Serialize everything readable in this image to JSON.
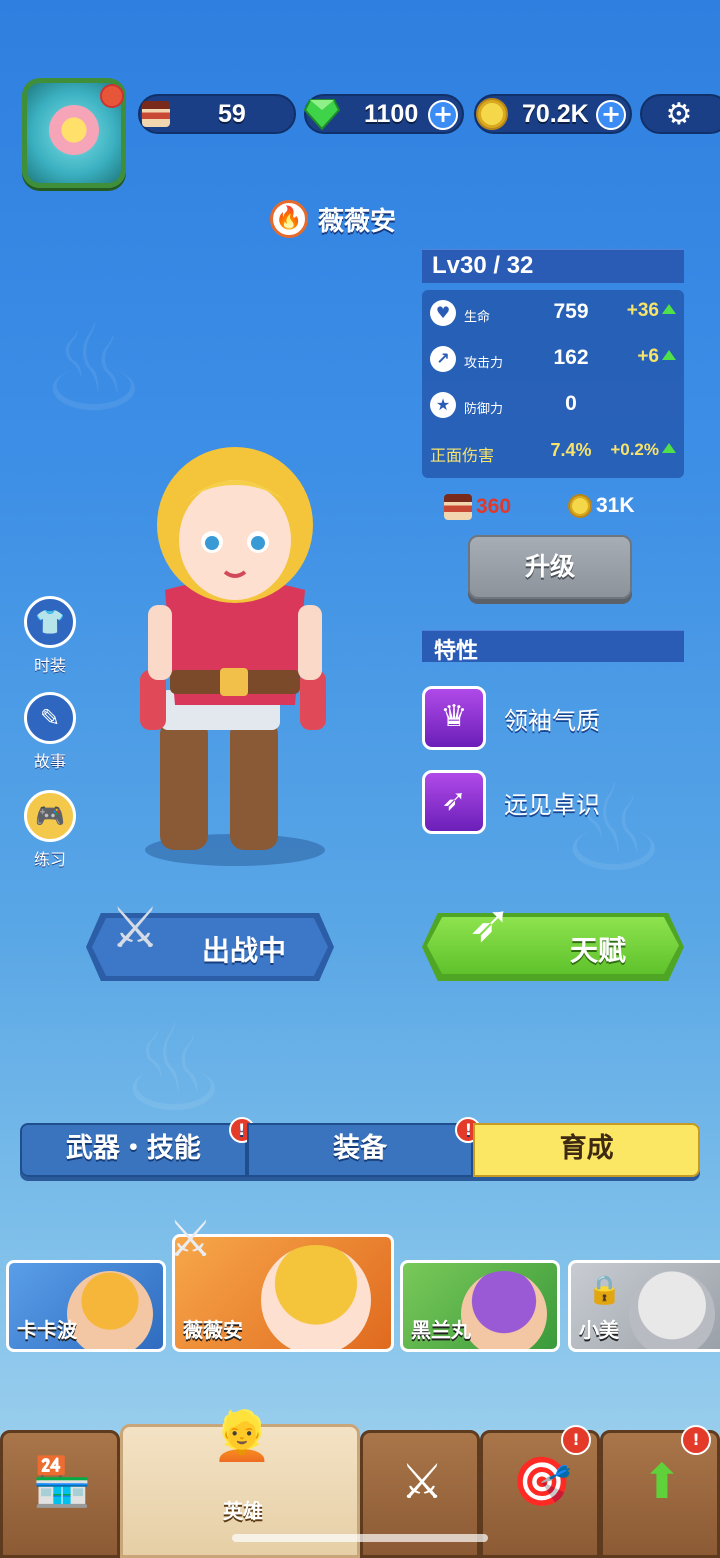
{
  "resources": {
    "cake": "59",
    "gems": "1100",
    "coins": "70.2K"
  },
  "hero": {
    "name": "薇薇安",
    "level": "Lv30 / 32"
  },
  "stats": [
    {
      "label": "生命",
      "value": "759",
      "bonus": "+36"
    },
    {
      "label": "攻击力",
      "value": "162",
      "bonus": "+6"
    },
    {
      "label": "防御力",
      "value": "0",
      "bonus": ""
    },
    {
      "label": "正面伤害",
      "value": "7.4%",
      "bonus": "+0.2%"
    }
  ],
  "upgrade_cost": {
    "cake": "360",
    "coins": "31K"
  },
  "upgrade_label": "升级",
  "traits_header": "特性",
  "traits": [
    {
      "name": "领袖气质",
      "icon": "crown-icon"
    },
    {
      "name": "远见卓识",
      "icon": "bow-icon"
    }
  ],
  "side_buttons": [
    {
      "label": "时装",
      "icon": "shirt-icon"
    },
    {
      "label": "故事",
      "icon": "book-icon"
    },
    {
      "label": "练习",
      "icon": "gamepad-icon"
    }
  ],
  "deploy_label": "出战中",
  "talent_label": "天赋",
  "tabs": [
    {
      "label": "武器・技能",
      "alert": true
    },
    {
      "label": "装备",
      "alert": true
    },
    {
      "label": "育成",
      "alert": false
    }
  ],
  "heroes": [
    {
      "name": "卡卡波",
      "locked": false
    },
    {
      "name": "薇薇安",
      "locked": false
    },
    {
      "name": "黑兰丸",
      "locked": false
    },
    {
      "name": "小美",
      "locked": true
    }
  ],
  "nav": [
    {
      "label": "",
      "icon": "shop-icon",
      "alert": false
    },
    {
      "label": "英雄",
      "icon": "hero-icon",
      "alert": false
    },
    {
      "label": "",
      "icon": "battle-icon",
      "alert": false
    },
    {
      "label": "",
      "icon": "target-icon",
      "alert": true
    },
    {
      "label": "",
      "icon": "upgrade-arrow-icon",
      "alert": true
    }
  ],
  "colors": {
    "accent_yellow": "#fbe764",
    "bonus_yellow": "#f8e36a",
    "alert_red": "#e33a2a",
    "talent_green": "#5fc22c"
  }
}
